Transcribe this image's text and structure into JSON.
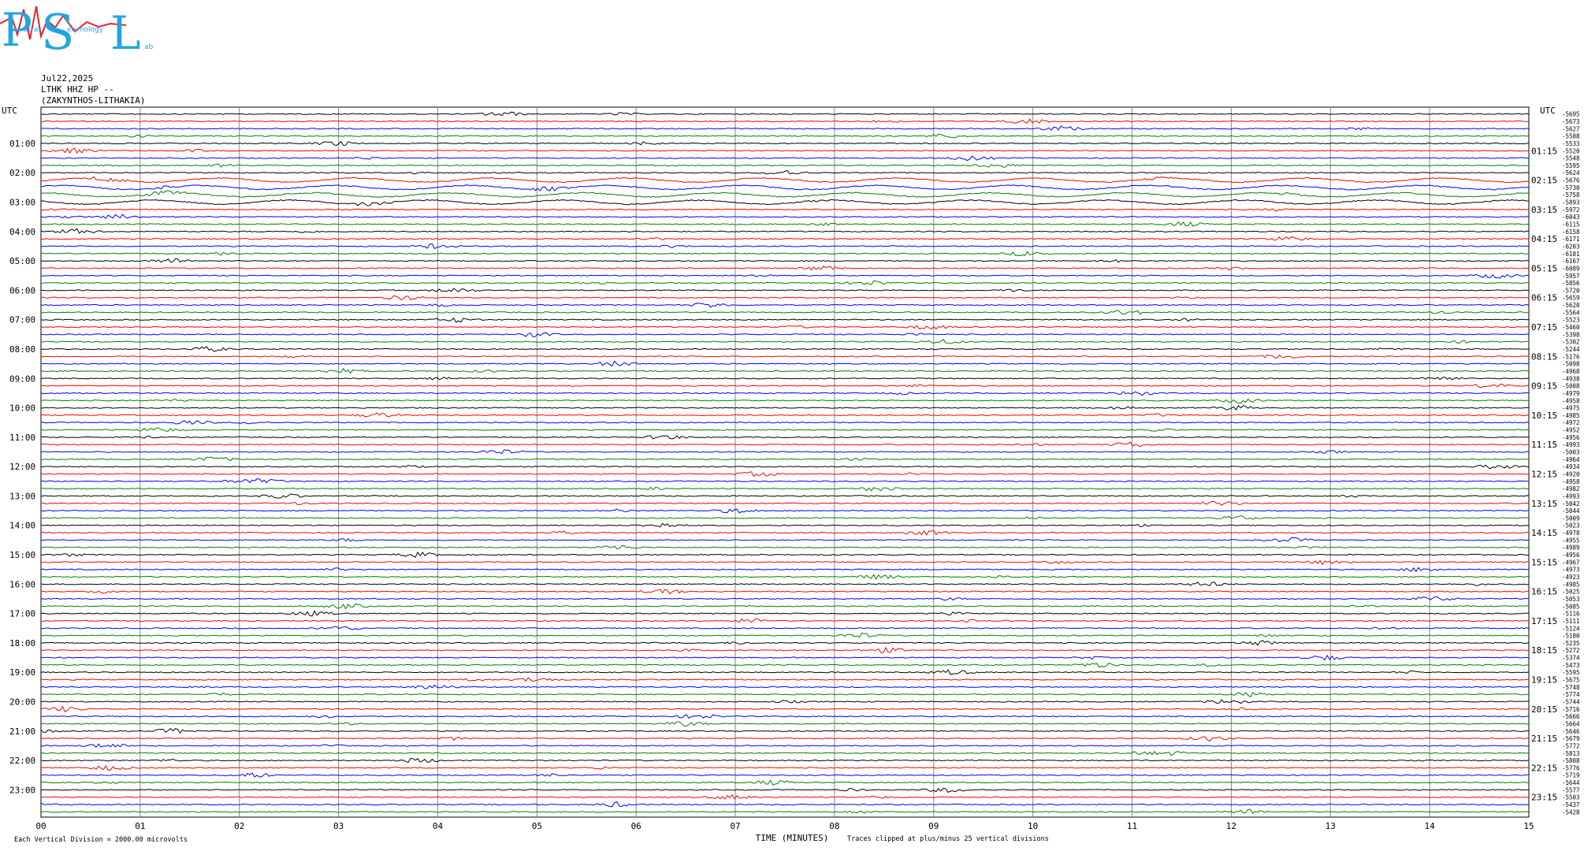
{
  "logo": {
    "big_letters": [
      "P",
      "S",
      "L"
    ],
    "small_text": [
      "atras",
      "eismology",
      "ab"
    ]
  },
  "header": {
    "date": "Jul22,2025",
    "station": "LTHK HHZ HP --",
    "location": "(ZAKYNTHOS-LITHAKIA)"
  },
  "labels": {
    "utc_left": "UTC",
    "utc_right": "UTC"
  },
  "chart_data": {
    "type": "line",
    "title": "",
    "xlabel": "TIME (MINUTES)",
    "xlim": [
      0,
      15
    ],
    "x_ticks": [
      "00",
      "01",
      "02",
      "03",
      "04",
      "05",
      "06",
      "07",
      "08",
      "09",
      "10",
      "11",
      "12",
      "13",
      "14",
      "15"
    ],
    "row_minutes": 15,
    "row_count": 96,
    "color_cycle": [
      "#000000",
      "#ff0000",
      "#0000ff",
      "#008000"
    ],
    "left_hour_labels": [
      "01:00",
      "02:00",
      "03:00",
      "04:00",
      "05:00",
      "06:00",
      "07:00",
      "08:00",
      "09:00",
      "10:00",
      "11:00",
      "12:00",
      "13:00",
      "14:00",
      "15:00",
      "16:00",
      "17:00",
      "18:00",
      "19:00",
      "20:00",
      "21:00",
      "22:00",
      "23:00"
    ],
    "right_hour_labels": [
      "01:15",
      "02:15",
      "03:15",
      "04:15",
      "05:15",
      "06:15",
      "07:15",
      "08:15",
      "09:15",
      "10:15",
      "11:15",
      "12:15",
      "13:15",
      "14:15",
      "15:15",
      "16:15",
      "17:15",
      "18:15",
      "19:15",
      "20:15",
      "21:15",
      "22:15",
      "23:15"
    ],
    "row_offsets": [
      "-5695",
      "-5673",
      "-5627",
      "-5588",
      "-5533",
      "-5520",
      "-5548",
      "-5595",
      "-5624",
      "-5676",
      "-5730",
      "-5758",
      "-5893",
      "-5972",
      "-6043",
      "-6115",
      "-6158",
      "-6171",
      "-6203",
      "-6181",
      "-6167",
      "-6089",
      "-5957",
      "-5856",
      "-5720",
      "-5659",
      "-5620",
      "-5564",
      "-5523",
      "-5460",
      "-5398",
      "-5302",
      "-5244",
      "-5176",
      "-5098",
      "-4968",
      "-4938",
      "-5008",
      "-4979",
      "-4958",
      "-4975",
      "-4985",
      "-4972",
      "-4952",
      "-4956",
      "-4993",
      "-5003",
      "-4964",
      "-4934",
      "-4920",
      "-4958",
      "-4982",
      "-4993",
      "-5042",
      "-5044",
      "-5009",
      "-5023",
      "-4978",
      "-4955",
      "-4989",
      "-4956",
      "-4967",
      "-4973",
      "-4923",
      "-4985",
      "-5025",
      "-5053",
      "-5085",
      "-5116",
      "-5111",
      "-5124",
      "-5180",
      "-5235",
      "-5272",
      "-5374",
      "-5473",
      "-5595",
      "-5675",
      "-5748",
      "-5774",
      "-5744",
      "-5716",
      "-5666",
      "-5664",
      "-5646",
      "-5679",
      "-5772",
      "-5813",
      "-5808",
      "-5776",
      "-5719",
      "-5644",
      "-5577",
      "-5503",
      "-5437",
      "-5428"
    ],
    "footer_left": "Each Vertical Division = 2000.00 microvolts",
    "footer_right": "Traces clipped at plus/minus 25 vertical divisions",
    "grid": true
  }
}
